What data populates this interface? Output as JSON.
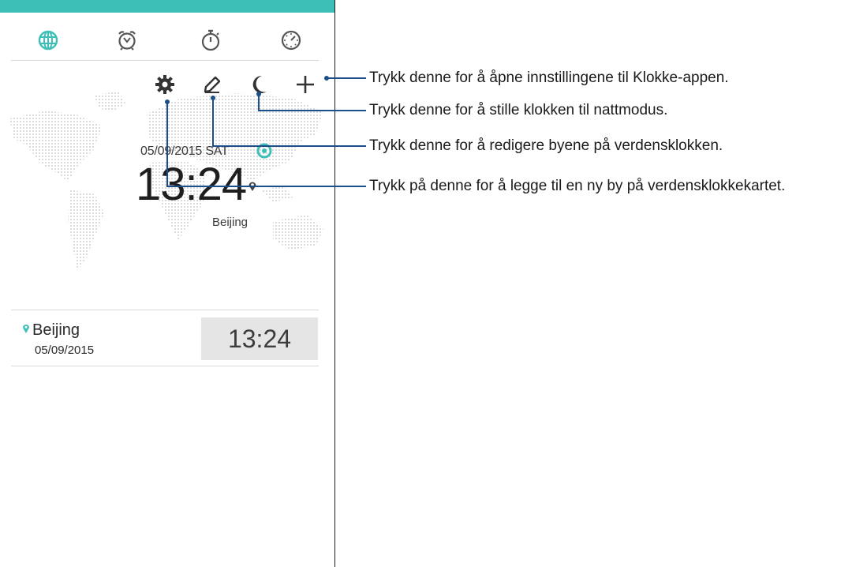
{
  "colors": {
    "accent": "#3dbfb8",
    "line": "#1c4f8a",
    "text": "#1e1e1e",
    "row_bg": "#e5e5e5"
  },
  "tabs": [
    {
      "name": "world-clock",
      "icon": "globe-icon",
      "active": true
    },
    {
      "name": "alarm",
      "icon": "alarm-clock-icon",
      "active": false
    },
    {
      "name": "stopwatch",
      "icon": "stopwatch-icon",
      "active": false
    },
    {
      "name": "timer",
      "icon": "timer-icon",
      "active": false
    }
  ],
  "toolbar": {
    "settings_icon": "gear-icon",
    "edit_icon": "pencil-icon",
    "night_icon": "moon-icon",
    "add_icon": "plus-icon"
  },
  "world_clock": {
    "date": "05/09/2015 SAT",
    "time": "13:24",
    "city": "Beijing"
  },
  "city_list": [
    {
      "city": "Beijing",
      "date": "05/09/2015",
      "time": "13:24"
    }
  ],
  "callouts": {
    "settings": "Trykk denne for å åpne innstillingene til Klokke-appen.",
    "night": "Trykk denne for å stille klokken til nattmodus.",
    "edit": "Trykk denne for å redigere byene på verdensklokken.",
    "add": "Trykk på denne for å legge til en ny by på verdensklokkekartet."
  }
}
